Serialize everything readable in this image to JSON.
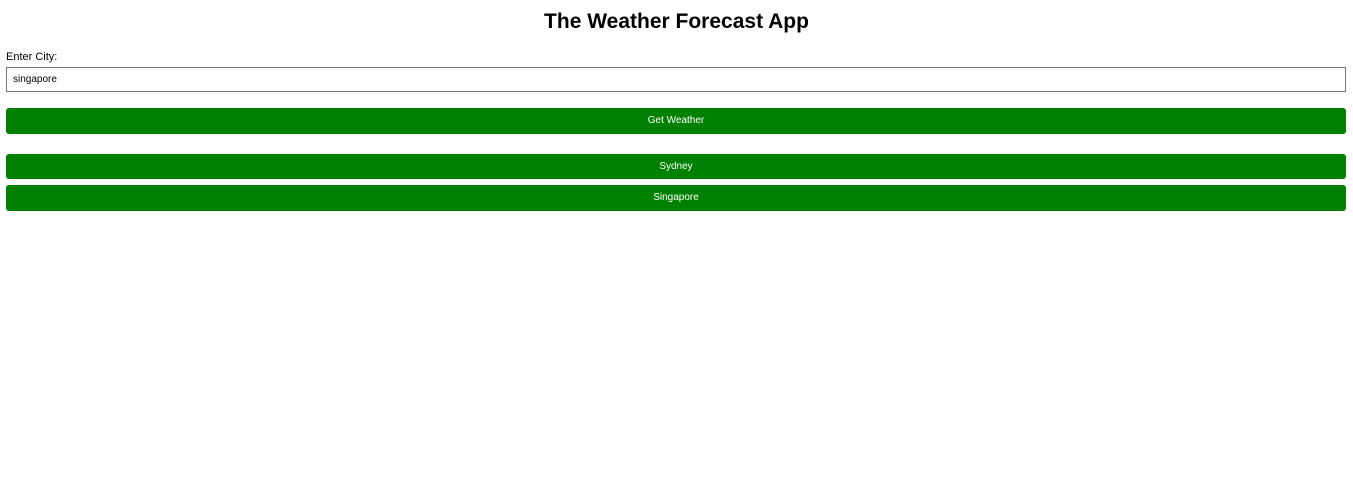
{
  "header": {
    "title": "The Weather Forecast App"
  },
  "form": {
    "city_label": "Enter City:",
    "city_value": "singapore",
    "submit_label": "Get Weather"
  },
  "history": {
    "items": [
      {
        "label": "Sydney"
      },
      {
        "label": "Singapore"
      }
    ]
  },
  "colors": {
    "button_bg": "#008000",
    "button_text": "#ffffff"
  }
}
